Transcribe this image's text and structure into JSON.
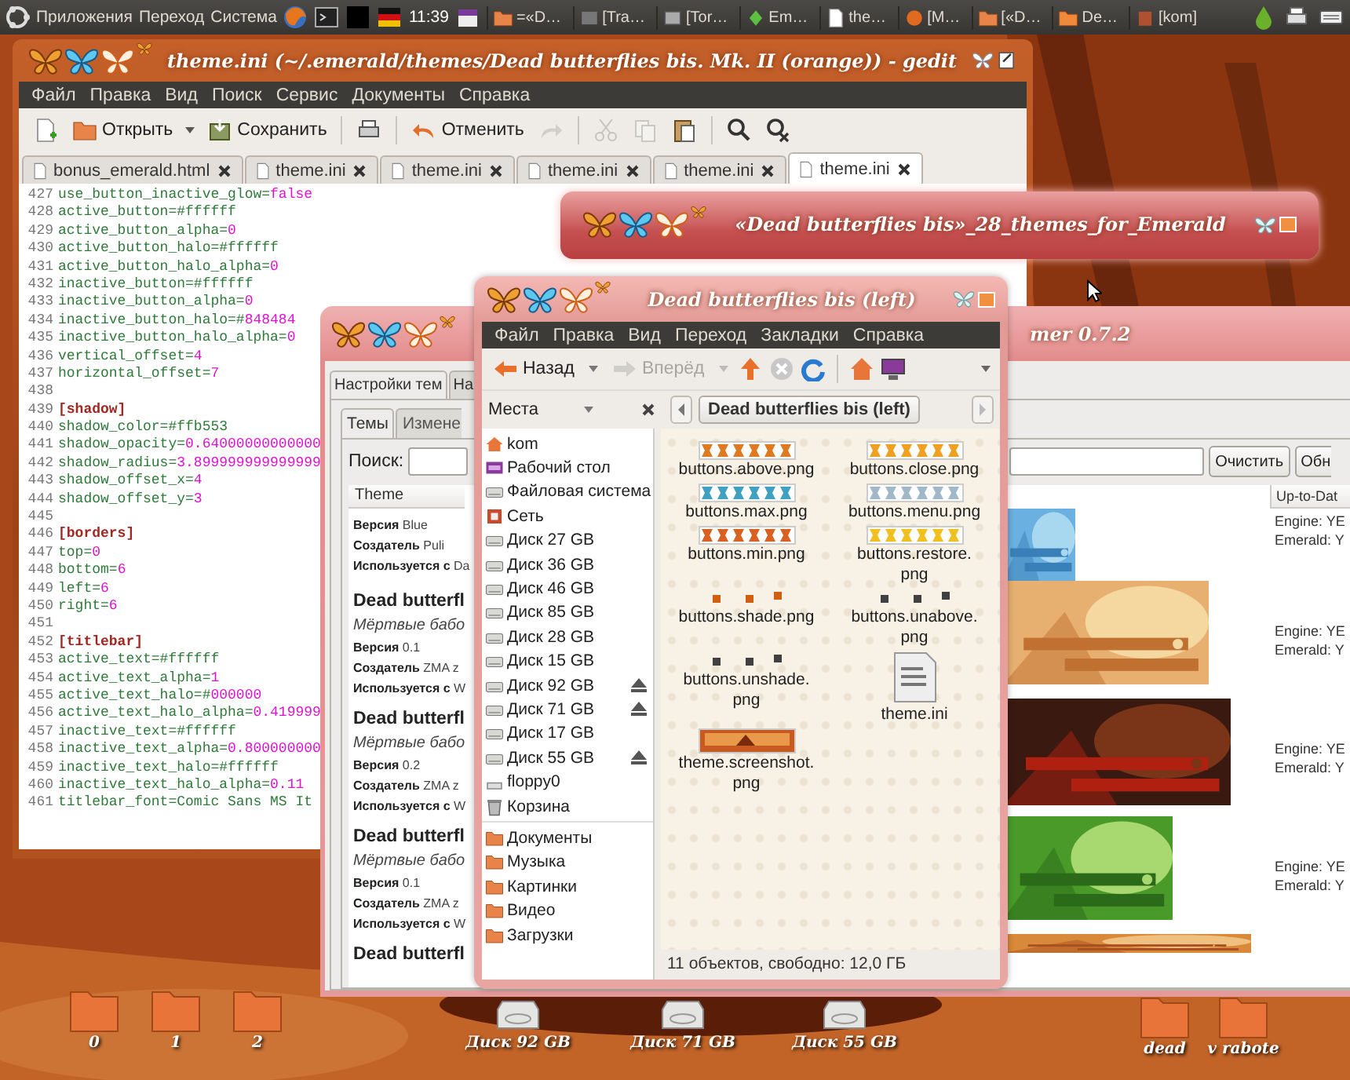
{
  "top_panel": {
    "menus": [
      "Приложения",
      "Переход",
      "Система"
    ],
    "clock": "11:39",
    "tasks": [
      "=«D…",
      "[Tra…",
      "[Tor…",
      "Em…",
      "the…",
      "[M…",
      "[«D…",
      "De…",
      "[kom]"
    ]
  },
  "gedit": {
    "title": "theme.ini (~/.emerald/themes/Dead butterflies bis. Mk. II (orange)) - gedit",
    "menu": [
      "Файл",
      "Правка",
      "Вид",
      "Поиск",
      "Сервис",
      "Документы",
      "Справка"
    ],
    "toolbar": [
      {
        "disabled": false
      },
      {
        "label": "Открыть",
        "disabled": false
      },
      {
        "label": "Сохранить",
        "disabled": false
      },
      {
        "disabled": false
      },
      {
        "label": "Отменить",
        "disabled": false
      },
      {
        "disabled": true
      },
      {
        "disabled": true
      },
      {
        "disabled": true
      },
      {
        "disabled": false
      },
      {
        "disabled": false
      },
      {
        "disabled": false
      }
    ],
    "tabs": [
      {
        "label": "bonus_emerald.html",
        "selected": false
      },
      {
        "label": "theme.ini",
        "selected": false
      },
      {
        "label": "theme.ini",
        "selected": false
      },
      {
        "label": "theme.ini",
        "selected": false
      },
      {
        "label": "theme.ini",
        "selected": false
      },
      {
        "label": "theme.ini",
        "selected": true
      }
    ],
    "lines": [
      {
        "n": "427",
        "text": "use_button_inactive_glow=",
        "value": "false"
      },
      {
        "n": "428",
        "text": "active_button=#ffffff"
      },
      {
        "n": "429",
        "text": "active_button_alpha=",
        "value": "0"
      },
      {
        "n": "430",
        "text": "active_button_halo=#ffffff"
      },
      {
        "n": "431",
        "text": "active_button_halo_alpha=",
        "value": "0"
      },
      {
        "n": "432",
        "text": "inactive_button=#ffffff"
      },
      {
        "n": "433",
        "text": "inactive_button_alpha=",
        "value": "0"
      },
      {
        "n": "434",
        "text": "inactive_button_halo=#",
        "value": "848484"
      },
      {
        "n": "435",
        "text": "inactive_button_halo_alpha=",
        "value": "0"
      },
      {
        "n": "436",
        "text": "vertical_offset=",
        "value": "4"
      },
      {
        "n": "437",
        "text": "horizontal_offset=",
        "value": "7"
      },
      {
        "n": "438"
      },
      {
        "n": "439",
        "kind": "section",
        "text": "[shadow]"
      },
      {
        "n": "440",
        "text": "shadow_color=#ffb553"
      },
      {
        "n": "441",
        "text": "shadow_opacity=",
        "value": "0.64000000000000"
      },
      {
        "n": "442",
        "text": "shadow_radius=",
        "value": "3.899999999999999"
      },
      {
        "n": "443",
        "text": "shadow_offset_x=",
        "value": "4"
      },
      {
        "n": "444",
        "text": "shadow_offset_y=",
        "value": "3"
      },
      {
        "n": "445"
      },
      {
        "n": "446",
        "kind": "section",
        "text": "[borders]"
      },
      {
        "n": "447",
        "text": "top=",
        "value": "0"
      },
      {
        "n": "448",
        "text": "bottom=",
        "value": "6"
      },
      {
        "n": "449",
        "text": "left=",
        "value": "6"
      },
      {
        "n": "450",
        "text": "right=",
        "value": "6"
      },
      {
        "n": "451"
      },
      {
        "n": "452",
        "kind": "section",
        "text": "[titlebar]"
      },
      {
        "n": "453",
        "text": "active_text=#ffffff"
      },
      {
        "n": "454",
        "text": "active_text_alpha=",
        "value": "1"
      },
      {
        "n": "455",
        "text": "active_text_halo=#",
        "value": "000000"
      },
      {
        "n": "456",
        "text": "active_text_halo_alpha=",
        "value": "0.419999"
      },
      {
        "n": "457",
        "text": "inactive_text=#ffffff"
      },
      {
        "n": "458",
        "text": "inactive_text_alpha=",
        "value": "0.800000000"
      },
      {
        "n": "459",
        "text": "inactive_text_halo=#ffffff"
      },
      {
        "n": "460",
        "text": "inactive_text_halo_alpha=",
        "value": "0.11"
      },
      {
        "n": "461",
        "text": "titlebar_font=Comic Sans MS It"
      }
    ]
  },
  "emerald_window": {
    "title": "«Dead butterflies bis»_28_themes_for_Emerald"
  },
  "themer": {
    "title": "mer 0.7.2",
    "tabs": [
      {
        "label": "Настройки тем",
        "selected": true
      },
      {
        "label": "На",
        "selected": false
      }
    ],
    "subtabs": [
      {
        "label": "Темы",
        "selected": true
      },
      {
        "label": "Измене",
        "selected": false
      }
    ],
    "search_label": "Поиск:",
    "buttons": [
      "Очистить",
      "Обн"
    ],
    "columns": [
      "Theme",
      "Up-to-Dat"
    ],
    "rows": [
      {
        "details": [
          {
            "label": "Версия",
            "value": "Blue"
          },
          {
            "label": "Создатель",
            "value": "Puli"
          },
          {
            "label": "Используется с",
            "value": "Da"
          }
        ],
        "status": [
          "Engine: YE",
          "Emerald: Y"
        ]
      },
      {
        "name": "Dead butterfl",
        "subtitle": "Мёртвые бабо",
        "details": [
          {
            "label": "Версия",
            "value": "0.1"
          },
          {
            "label": "Создатель",
            "value": "ZMA z"
          },
          {
            "label": "Используется с",
            "value": "W"
          }
        ],
        "status": [
          "Engine: YE",
          "Emerald: Y"
        ]
      },
      {
        "name": "Dead butterfl",
        "subtitle": "Мёртвые бабо",
        "details": [
          {
            "label": "Версия",
            "value": "0.2"
          },
          {
            "label": "Создатель",
            "value": "ZMA z"
          },
          {
            "label": "Используется с",
            "value": "W"
          }
        ],
        "status": [
          "Engine: YE",
          "Emerald: Y"
        ]
      },
      {
        "name": "Dead butterfl",
        "subtitle": "Мёртвые бабо",
        "details": [
          {
            "label": "Версия",
            "value": "0.1"
          },
          {
            "label": "Создатель",
            "value": "ZMA z"
          },
          {
            "label": "Используется с",
            "value": "W"
          }
        ],
        "status": [
          "Engine: YE",
          "Emerald: Y"
        ]
      },
      {
        "name": "Dead butterfl"
      }
    ]
  },
  "nautilus": {
    "title": "Dead butterflies bis (left)",
    "menu": [
      "Файл",
      "Правка",
      "Вид",
      "Переход",
      "Закладки",
      "Справка"
    ],
    "back": {
      "label": "Назад",
      "disabled": false
    },
    "forward": {
      "label": "Вперёд",
      "disabled": true
    },
    "places_label": "Места",
    "path": "Dead butterflies bis (left)",
    "places": [
      {
        "label": "kom",
        "kind": "home",
        "eject": false
      },
      {
        "label": "Рабочий стол",
        "kind": "desktop",
        "eject": false
      },
      {
        "label": "Файловая система",
        "kind": "drive",
        "eject": false
      },
      {
        "label": "Сеть",
        "kind": "network",
        "eject": false
      },
      {
        "label": "Диск 27 GB",
        "kind": "drive",
        "eject": false
      },
      {
        "label": "Диск 36 GB",
        "kind": "drive",
        "eject": false
      },
      {
        "label": "Диск 46 GB",
        "kind": "drive",
        "eject": false
      },
      {
        "label": "Диск 85 GB",
        "kind": "drive",
        "eject": false
      },
      {
        "label": "Диск 28 GB",
        "kind": "drive",
        "eject": false
      },
      {
        "label": "Диск 15 GB",
        "kind": "drive",
        "eject": false
      },
      {
        "label": "Диск 92 GB",
        "kind": "drive",
        "eject": true
      },
      {
        "label": "Диск 71 GB",
        "kind": "drive",
        "eject": true
      },
      {
        "label": "Диск 17 GB",
        "kind": "drive",
        "eject": false
      },
      {
        "label": "Диск 55 GB",
        "kind": "drive",
        "eject": true
      },
      {
        "label": "floppy0",
        "kind": "floppy",
        "eject": false
      },
      {
        "label": "Корзина",
        "kind": "trash",
        "eject": false
      }
    ],
    "bookmarks": [
      "Документы",
      "Музыка",
      "Картинки",
      "Видео",
      "Загрузки"
    ],
    "files": [
      {
        "name": "buttons.above.png",
        "kind": "strip",
        "color": "#e07a20"
      },
      {
        "name": "buttons.close.png",
        "kind": "strip",
        "color": "#f0a020"
      },
      {
        "name": "buttons.max.png",
        "kind": "strip",
        "color": "#40a0c0"
      },
      {
        "name": "buttons.menu.png",
        "kind": "strip",
        "color": "#a0b8c8"
      },
      {
        "name": "buttons.min.png",
        "kind": "strip",
        "color": "#d86020"
      },
      {
        "name": "buttons.restore.png",
        "kind": "strip",
        "color": "#f0c020"
      },
      {
        "name": "buttons.shade.png",
        "kind": "dots",
        "color": "#d06010"
      },
      {
        "name": "buttons.unabove.png",
        "kind": "dots",
        "color": "#404040"
      },
      {
        "name": "buttons.unshade.png",
        "kind": "dots",
        "color": "#404040"
      },
      {
        "name": "theme.ini",
        "kind": "text"
      },
      {
        "name": "theme.screenshot.png"
      }
    ],
    "status": "11 объектов, свободно: 12,0 ГБ"
  },
  "desktop_icons": [
    {
      "label": "0",
      "kind": "folder"
    },
    {
      "label": "1",
      "kind": "folder"
    },
    {
      "label": "2",
      "kind": "folder"
    },
    {
      "label": "Диск 92 GB",
      "kind": "drive"
    },
    {
      "label": "Диск 71 GB",
      "kind": "drive"
    },
    {
      "label": "Диск 55 GB",
      "kind": "drive"
    },
    {
      "label": "dead",
      "kind": "folder"
    },
    {
      "label": "v rabote",
      "kind": "folder"
    }
  ]
}
